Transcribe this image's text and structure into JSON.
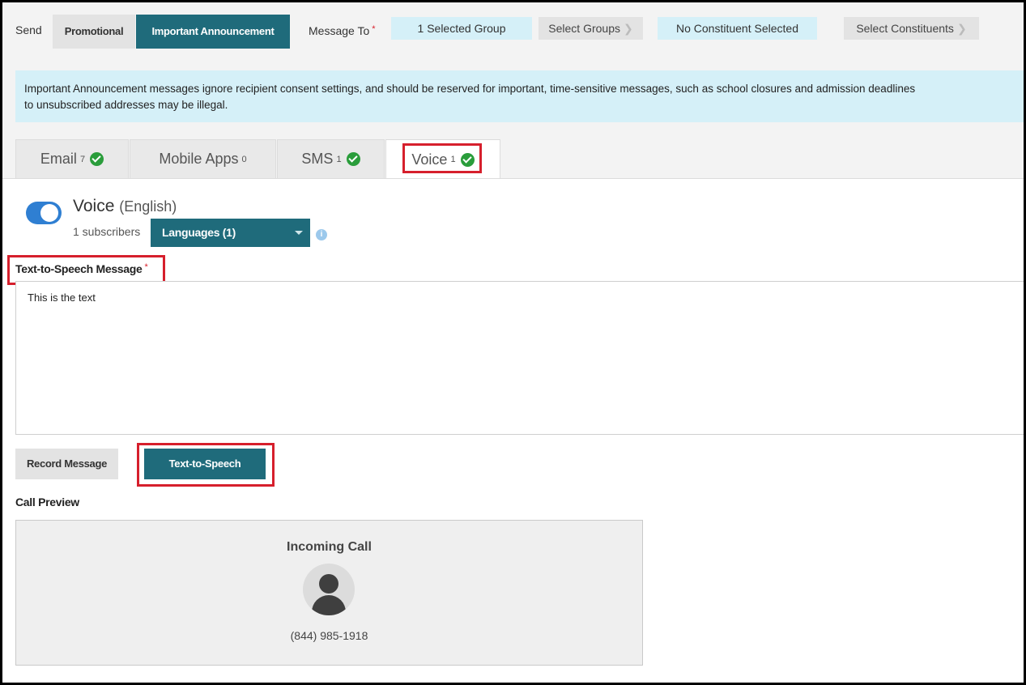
{
  "header": {
    "send_label": "Send",
    "promotional": "Promotional",
    "important": "Important Announcement",
    "message_to": "Message To",
    "required_mark": "*",
    "selected_groups": "1 Selected Group",
    "select_groups": "Select Groups",
    "constituents": "No Constituent Selected",
    "select_constituents": "Select Constituents"
  },
  "notice": {
    "line1": "Important Announcement messages ignore recipient consent settings, and should be reserved for important, time-sensitive messages, such as school closures and admission deadlines",
    "line2": "to unsubscribed addresses may be illegal."
  },
  "tabs": [
    {
      "label": "Email",
      "count": "7",
      "ok": true
    },
    {
      "label": "Mobile Apps",
      "count": "0",
      "ok": false
    },
    {
      "label": "SMS",
      "count": "1",
      "ok": true
    },
    {
      "label": "Voice",
      "count": "1",
      "ok": true
    }
  ],
  "voice": {
    "title": "Voice",
    "language": "(English)",
    "subscribers": "1 subscribers",
    "languages_button": "Languages (1)",
    "info_glyph": "i",
    "toggle_on": true
  },
  "tts": {
    "label": "Text-to-Speech Message",
    "value": "This is the text"
  },
  "mode_buttons": {
    "record": "Record Message",
    "tts": "Text-to-Speech",
    "active": "Text-to-Speech"
  },
  "preview": {
    "label": "Call Preview",
    "incoming": "Incoming Call",
    "phone": "(844) 985-1918"
  },
  "colors": {
    "accent": "#1f6b7b",
    "highlight": "#d61f2c",
    "success": "#2a9d3b",
    "info_bg": "#d5f0f8",
    "toggle": "#2f7fd2"
  }
}
